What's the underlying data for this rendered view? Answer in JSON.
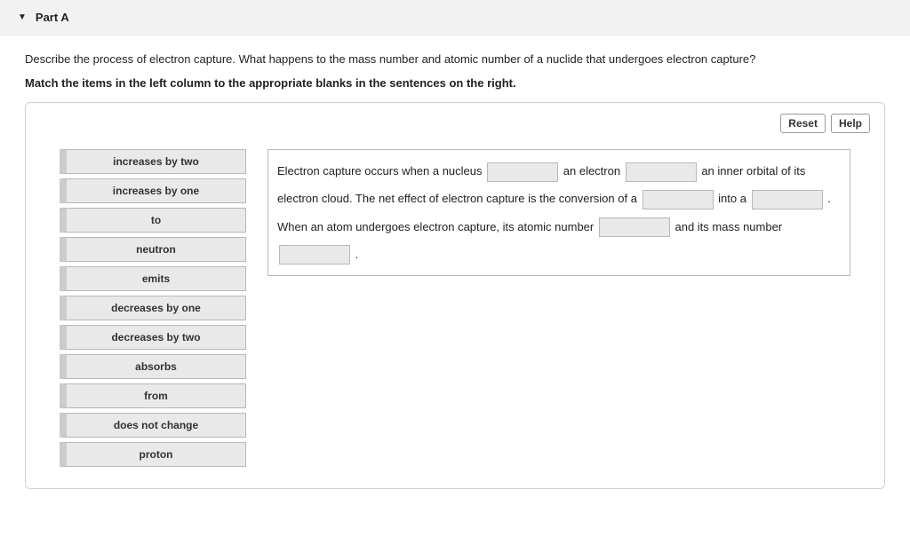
{
  "header": {
    "title": "Part A"
  },
  "prompt": "Describe the process of electron capture. What happens to the mass number and atomic number of a nuclide that undergoes electron capture?",
  "instruction": "Match the items in the left column to the appropriate blanks in the sentences on the right.",
  "toolbar": {
    "reset": "Reset",
    "help": "Help"
  },
  "drag_items": [
    "increases by two",
    "increases by one",
    "to",
    "neutron",
    "emits",
    "decreases by one",
    "decreases by two",
    "absorbs",
    "from",
    "does not change",
    "proton"
  ],
  "sentence": {
    "seg1": "Electron capture occurs when a nucleus ",
    "seg2": " an electron ",
    "seg3": " an inner orbital of its electron cloud. The net effect of electron capture is the conversion of a ",
    "seg4": " into a ",
    "seg5": " . When an atom undergoes electron capture, its atomic number ",
    "seg6": " and its mass number ",
    "seg7": " ."
  }
}
